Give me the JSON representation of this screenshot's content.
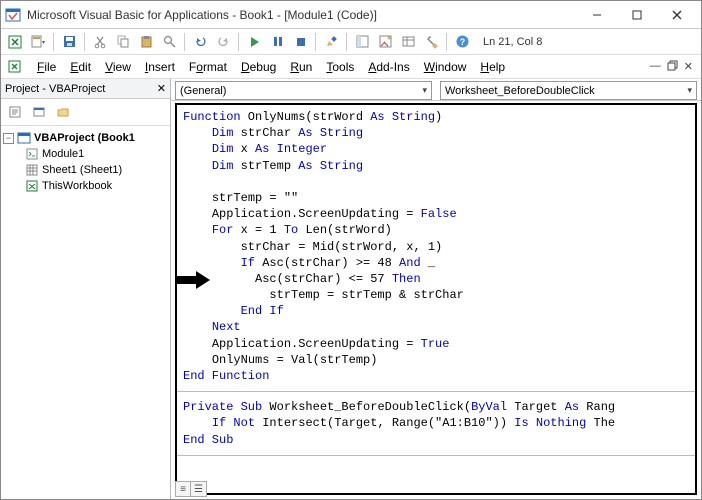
{
  "window": {
    "title": "Microsoft Visual Basic for Applications - Book1 - [Module1 (Code)]"
  },
  "position": {
    "text": "Ln 21, Col 8"
  },
  "menu": {
    "file": "File",
    "edit": "Edit",
    "view": "View",
    "insert": "Insert",
    "format": "Format",
    "debug": "Debug",
    "run": "Run",
    "tools": "Tools",
    "addins": "Add-Ins",
    "window": "Window",
    "help": "Help"
  },
  "project": {
    "title": "Project - VBAProject",
    "root": "VBAProject (Book1",
    "nodes": {
      "module1": "Module1",
      "sheet1": "Sheet1 (Sheet1)",
      "thiswb": "ThisWorkbook"
    }
  },
  "selectors": {
    "left": "(General)",
    "right": "Worksheet_BeforeDoubleClick"
  },
  "code": {
    "func_decl_1": "Function",
    "func_decl_2": " OnlyNums(strWord ",
    "func_decl_3": "As String",
    "func_decl_4": ")",
    "dim1a": "Dim",
    "dim1b": " strChar ",
    "dim1c": "As String",
    "dim2a": "Dim",
    "dim2b": " x ",
    "dim2c": "As Integer",
    "dim3a": "Dim",
    "dim3b": " strTemp ",
    "dim3c": "As String",
    "l5": "strTemp = \"\"",
    "l6a": "Application.ScreenUpdating = ",
    "l6b": "False",
    "l7a": "For",
    "l7b": " x = 1 ",
    "l7c": "To",
    "l7d": " Len(strWord)",
    "l8": "strChar = Mid(strWord, x, 1)",
    "l9a": "If",
    "l9b": " Asc(strChar) >= 48 ",
    "l9c": "And",
    "l9d": " _",
    "l10a": "  Asc(strChar) <= 57 ",
    "l10b": "Then",
    "l11": "    strTemp = strTemp & strChar",
    "l12": "End If",
    "l13": "Next",
    "l14a": "Application.ScreenUpdating = ",
    "l14b": "True",
    "l15": "OnlyNums = Val(strTemp)",
    "l16": "End Function",
    "s1a": "Private Sub",
    "s1b": " Worksheet_BeforeDoubleClick(",
    "s1c": "ByVal",
    "s1d": " Target ",
    "s1e": "As",
    "s1f": " Rang",
    "s2a": "If Not",
    "s2b": " Intersect(Target, Range(\"A1:B10\")) ",
    "s2c": "Is Nothing",
    "s2d": " The",
    "s3": "End Sub"
  }
}
